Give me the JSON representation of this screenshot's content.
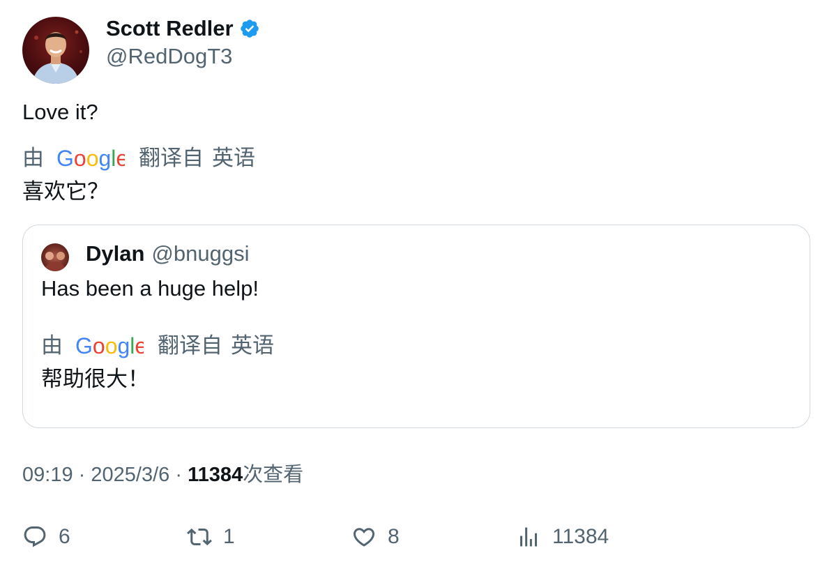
{
  "author": {
    "name": "Scott Redler",
    "handle": "@RedDogT3",
    "verified": true,
    "verified_color": "#1d9bf0"
  },
  "tweet": {
    "text": "Love it?",
    "translation": {
      "by_label": "由",
      "provider": "Google",
      "from_label": "翻译自",
      "language": "英语",
      "text": "喜欢它？"
    }
  },
  "quote": {
    "name": "Dylan",
    "handle": "@bnuggsi",
    "text": "Has been a huge help!",
    "translation": {
      "by_label": "由",
      "provider": "Google",
      "from_label": "翻译自",
      "language": "英语",
      "text": "帮助很大！"
    }
  },
  "meta": {
    "time": "09:19",
    "separator": "·",
    "date": "2025/3/6",
    "views_count": "11384",
    "views_label": "次查看"
  },
  "actions": {
    "replies": "6",
    "retweets": "1",
    "likes": "8",
    "views": "11384"
  },
  "colors": {
    "text_primary": "#0f1419",
    "text_secondary": "#536471",
    "border": "#cfd9de",
    "google_blue": "#4285F4",
    "google_red": "#EA4335",
    "google_yellow": "#FBBC05",
    "google_green": "#34A853"
  }
}
